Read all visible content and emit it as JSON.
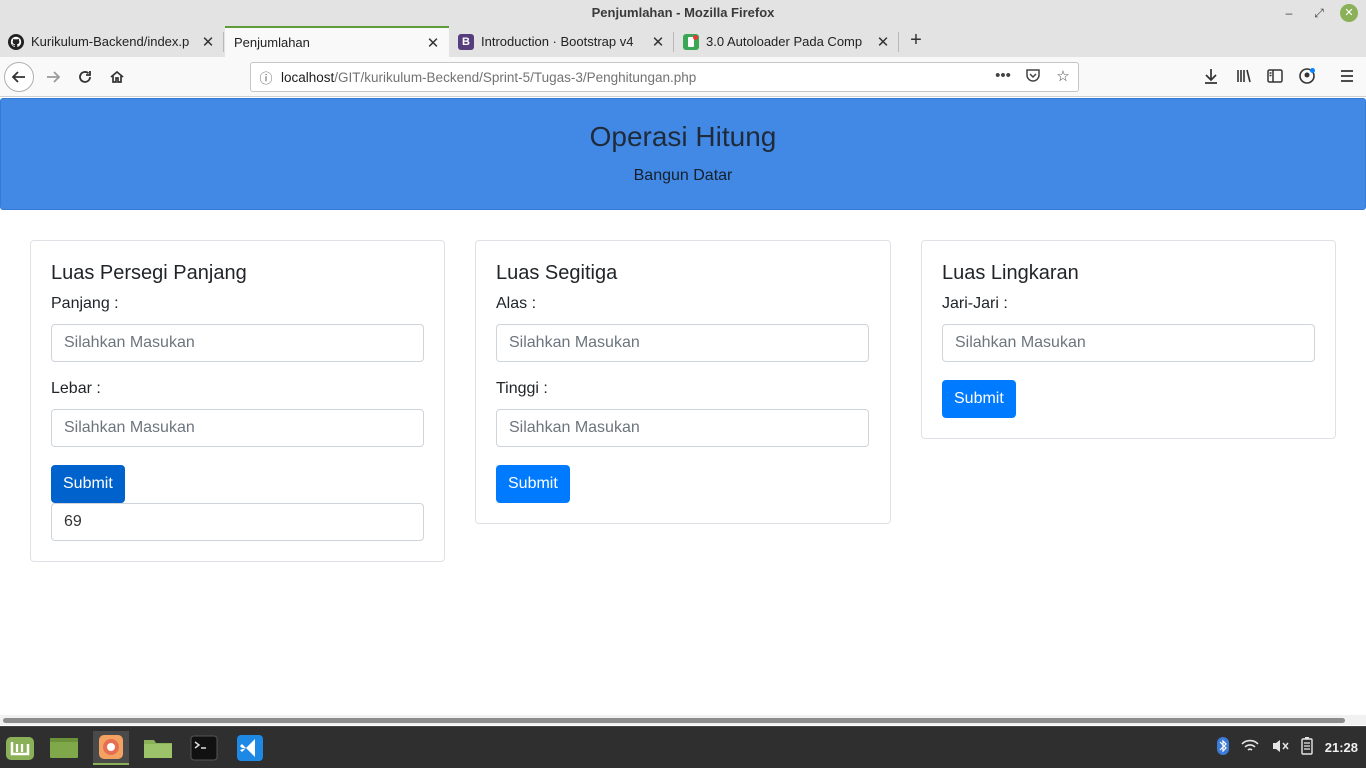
{
  "window": {
    "title": "Penjumlahan - Mozilla Firefox"
  },
  "tabs": [
    {
      "label": "Kurikulum-Backend/index.p",
      "icon": "github-icon"
    },
    {
      "label": "Penjumlahan",
      "icon": "none",
      "active": true
    },
    {
      "label": "Introduction · Bootstrap v4",
      "icon": "bootstrap-icon",
      "icon_letter": "B",
      "icon_color": "#563d7c"
    },
    {
      "label": "3.0 Autoloader Pada Comp",
      "icon": "codepolitan-icon",
      "icon_color": "#3aa757"
    }
  ],
  "urlbar": {
    "host": "localhost",
    "path": "/GIT/kurikulum-Beckend/Sprint-5/Tugas-3/Penghitungan.php"
  },
  "header": {
    "title": "Operasi Hitung",
    "subtitle": "Bangun Datar"
  },
  "cards": {
    "rectangle": {
      "title": "Luas Persegi Panjang",
      "field1_label": "Panjang :",
      "field1_placeholder": "Silahkan Masukan",
      "field2_label": "Lebar :",
      "field2_placeholder": "Silahkan Masukan",
      "submit_label": "Submit",
      "result": "69"
    },
    "triangle": {
      "title": "Luas Segitiga",
      "field1_label": "Alas :",
      "field1_placeholder": "Silahkan Masukan",
      "field2_label": "Tinggi :",
      "field2_placeholder": "Silahkan Masukan",
      "submit_label": "Submit"
    },
    "circle": {
      "title": "Luas Lingkaran",
      "field1_label": "Jari-Jari :",
      "field1_placeholder": "Silahkan Masukan",
      "submit_label": "Submit"
    }
  },
  "taskbar": {
    "clock": "21:28"
  },
  "colors": {
    "jumbotron": "#4289e6",
    "primary_button": "#007bff",
    "active_tab_accent": "#5e9c3a"
  }
}
